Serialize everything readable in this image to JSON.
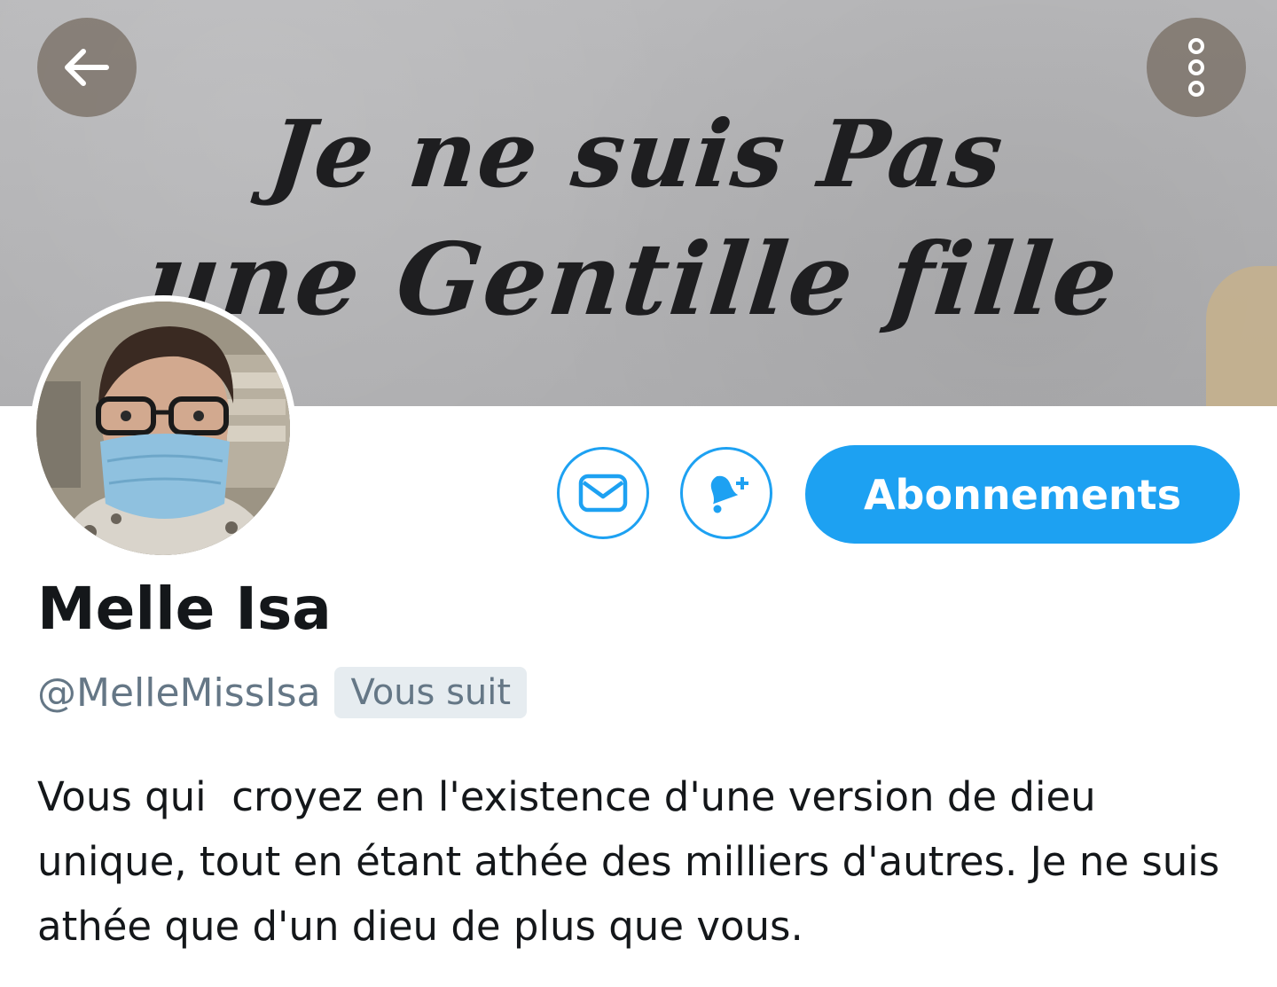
{
  "banner": {
    "line1": "Je ne suis Pas",
    "line2": "une Gentille fille"
  },
  "nav": {
    "back_icon": "arrow-left-icon",
    "more_icon": "more-vertical-icon"
  },
  "profile": {
    "display_name": "Melle Isa",
    "handle": "@MelleMissIsa",
    "follows_you": "Vous suit",
    "bio": "Vous qui  croyez en l'existence d'une version de dieu unique, tout en étant athée des milliers d'autres. Je ne suis athée que d'un dieu de plus que vous."
  },
  "actions": {
    "message_icon": "envelope-icon",
    "notify_icon": "bell-plus-icon",
    "follow_label": "Abonnements"
  },
  "colors": {
    "accent": "#1da1f2",
    "secondary_text": "#657786",
    "primary_text": "#14171a",
    "badge_bg": "#e6ecf0"
  }
}
